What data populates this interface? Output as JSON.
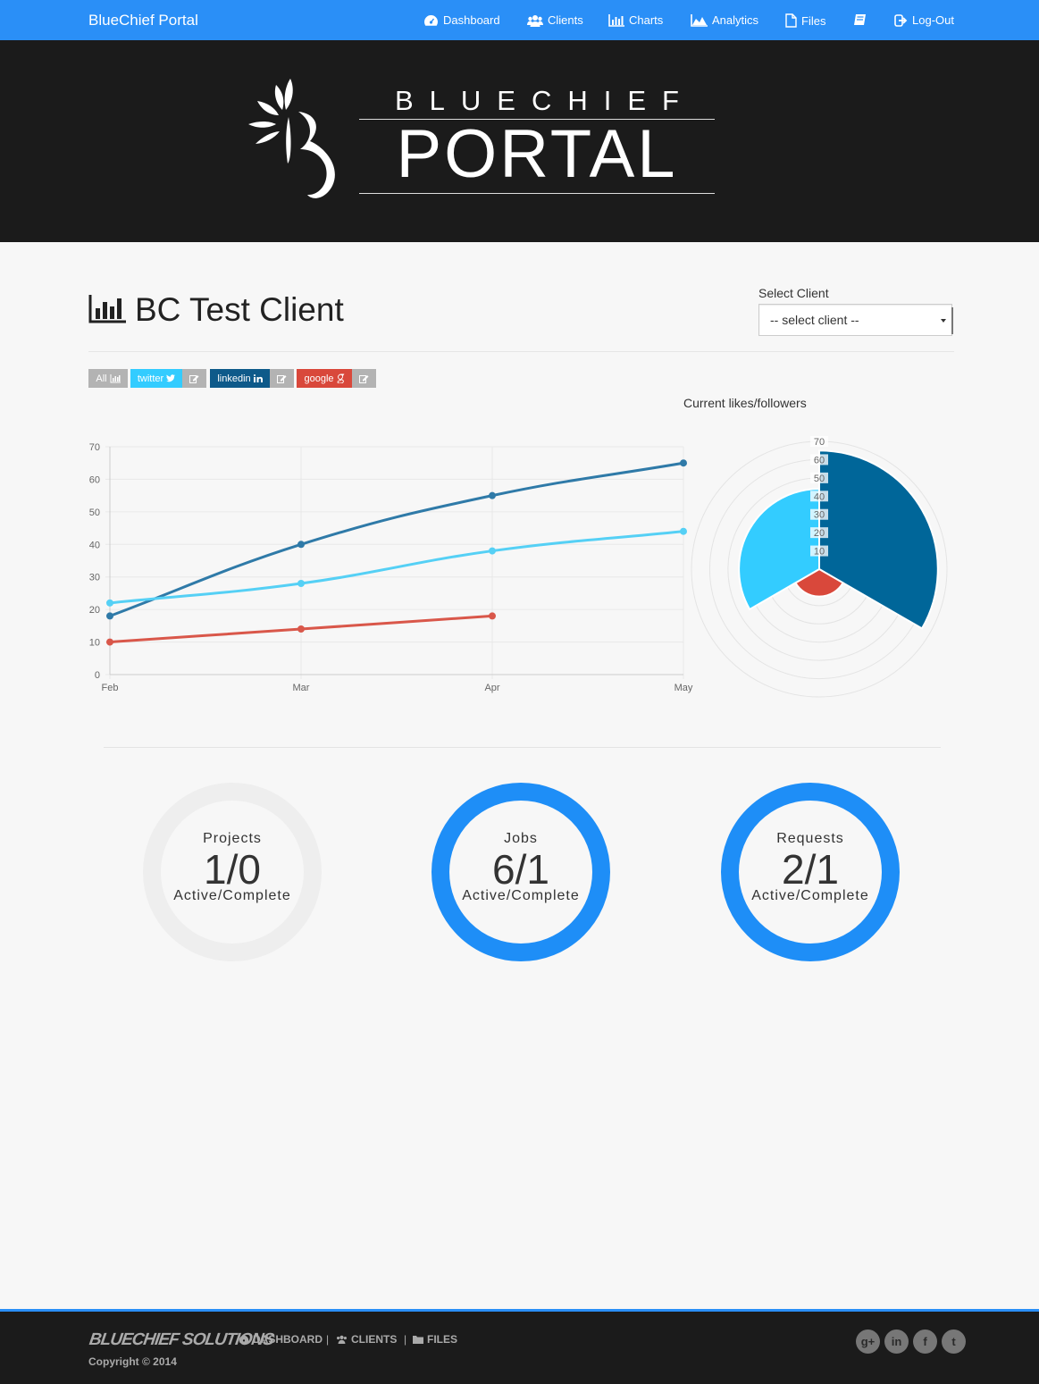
{
  "navbar": {
    "brand": "BlueChief Portal",
    "items": [
      {
        "label": "Dashboard",
        "icon": "dashboard-icon"
      },
      {
        "label": "Clients",
        "icon": "users-icon"
      },
      {
        "label": "Charts",
        "icon": "bar-chart-icon"
      },
      {
        "label": "Analytics",
        "icon": "area-chart-icon"
      },
      {
        "label": "Files",
        "icon": "file-icon"
      },
      {
        "label": "",
        "icon": "book-icon"
      },
      {
        "label": "Log-Out",
        "icon": "sign-out-icon"
      }
    ]
  },
  "hero": {
    "logo_top": "BLUECHIEF",
    "logo_main": "PORTAL"
  },
  "client": {
    "title": "BC Test Client",
    "select_label": "Select Client",
    "select_value": "-- select client --"
  },
  "filters": [
    {
      "label": "All",
      "icon": "bar-chart-icon",
      "color": "#b3b3b3"
    },
    {
      "label": "twitter",
      "icon": "twitter-icon",
      "color": "#33ccff"
    },
    {
      "label": "linkedin",
      "icon": "linkedin-icon",
      "color": "#0e5a8a"
    },
    {
      "label": "google",
      "icon": "google-plus-icon",
      "color": "#d9483b"
    }
  ],
  "polar_title": "Current likes/followers",
  "chart_data": [
    {
      "type": "line",
      "x": [
        "Feb",
        "Mar",
        "Apr",
        "May"
      ],
      "ylim": [
        0,
        70
      ],
      "yticks": [
        0,
        10,
        20,
        30,
        40,
        50,
        60,
        70
      ],
      "grid": true,
      "series": [
        {
          "color": "#2f7aa8",
          "values": [
            18,
            40,
            55,
            65
          ]
        },
        {
          "color": "#55d0f5",
          "values": [
            22,
            28,
            38,
            44
          ]
        },
        {
          "color": "#d9574a",
          "values": [
            10,
            14,
            18,
            null
          ]
        }
      ]
    },
    {
      "type": "polar_area",
      "rlim": [
        0,
        70
      ],
      "ticks": [
        10,
        20,
        30,
        40,
        50,
        60,
        70
      ],
      "segments": [
        {
          "color": "#006699",
          "value": 65
        },
        {
          "color": "#d9483b",
          "value": 15
        },
        {
          "color": "#33ccff",
          "value": 44
        }
      ]
    }
  ],
  "stats": [
    {
      "label": "Projects",
      "value": "1/0",
      "sub": "Active/Complete",
      "ring_color": "#eeeeee"
    },
    {
      "label": "Jobs",
      "value": "6/1",
      "sub": "Active/Complete",
      "ring_color": "#1e8ef7"
    },
    {
      "label": "Requests",
      "value": "2/1",
      "sub": "Active/Complete",
      "ring_color": "#1e8ef7"
    }
  ],
  "footer": {
    "brand": "BLUECHIEF SOLUTIONS",
    "links": [
      {
        "label": "DASHBOARD",
        "icon": "dashboard-icon"
      },
      {
        "label": "CLIENTS",
        "icon": "users-icon"
      },
      {
        "label": "FILES",
        "icon": "folder-icon"
      }
    ],
    "separator": "|",
    "copyright": "Copyright © 2014",
    "social": [
      {
        "icon": "google-plus-icon",
        "glyph": "g+"
      },
      {
        "icon": "linkedin-icon",
        "glyph": "in"
      },
      {
        "icon": "facebook-icon",
        "glyph": "f"
      },
      {
        "icon": "twitter-icon",
        "glyph": "t"
      }
    ]
  }
}
